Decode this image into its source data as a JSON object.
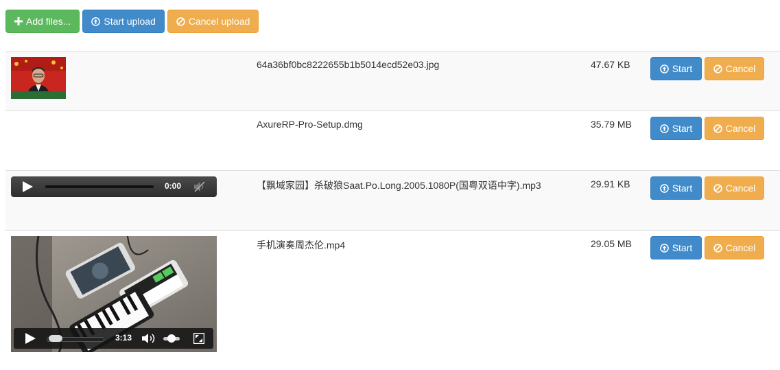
{
  "toolbar": {
    "add_files_label": "Add files...",
    "start_upload_label": "Start upload",
    "cancel_upload_label": "Cancel upload"
  },
  "colors": {
    "success": "#5cb85c",
    "primary": "#428bca",
    "warning": "#f0ad4e",
    "row_stripe": "#f9f9f9"
  },
  "files": [
    {
      "name": "64a36bf0bc8222655b1b5014ecd52e03.jpg",
      "size": "47.67 KB",
      "preview": "image",
      "start_label": "Start",
      "cancel_label": "Cancel"
    },
    {
      "name": "AxureRP-Pro-Setup.dmg",
      "size": "35.79 MB",
      "preview": "none",
      "start_label": "Start",
      "cancel_label": "Cancel"
    },
    {
      "name": "【飘域家园】杀破狼Saat.Po.Long.2005.1080P(国粤双语中字).mp3",
      "size": "29.91 KB",
      "preview": "audio",
      "start_label": "Start",
      "cancel_label": "Cancel",
      "player": {
        "time": "0:00",
        "muted": true
      }
    },
    {
      "name": "手机演奏周杰伦.mp4",
      "size": "29.05 MB",
      "preview": "video",
      "start_label": "Start",
      "cancel_label": "Cancel",
      "player": {
        "time": "3:13",
        "progress": 0.05,
        "volume": 0.5
      }
    }
  ],
  "icons": {
    "add": "plus-icon",
    "start": "circle-arrow-up-icon",
    "cancel": "ban-circle-icon",
    "play": "play-icon",
    "volume": "volume-icon",
    "mute": "volume-muted-icon",
    "fullscreen": "fullscreen-icon"
  }
}
